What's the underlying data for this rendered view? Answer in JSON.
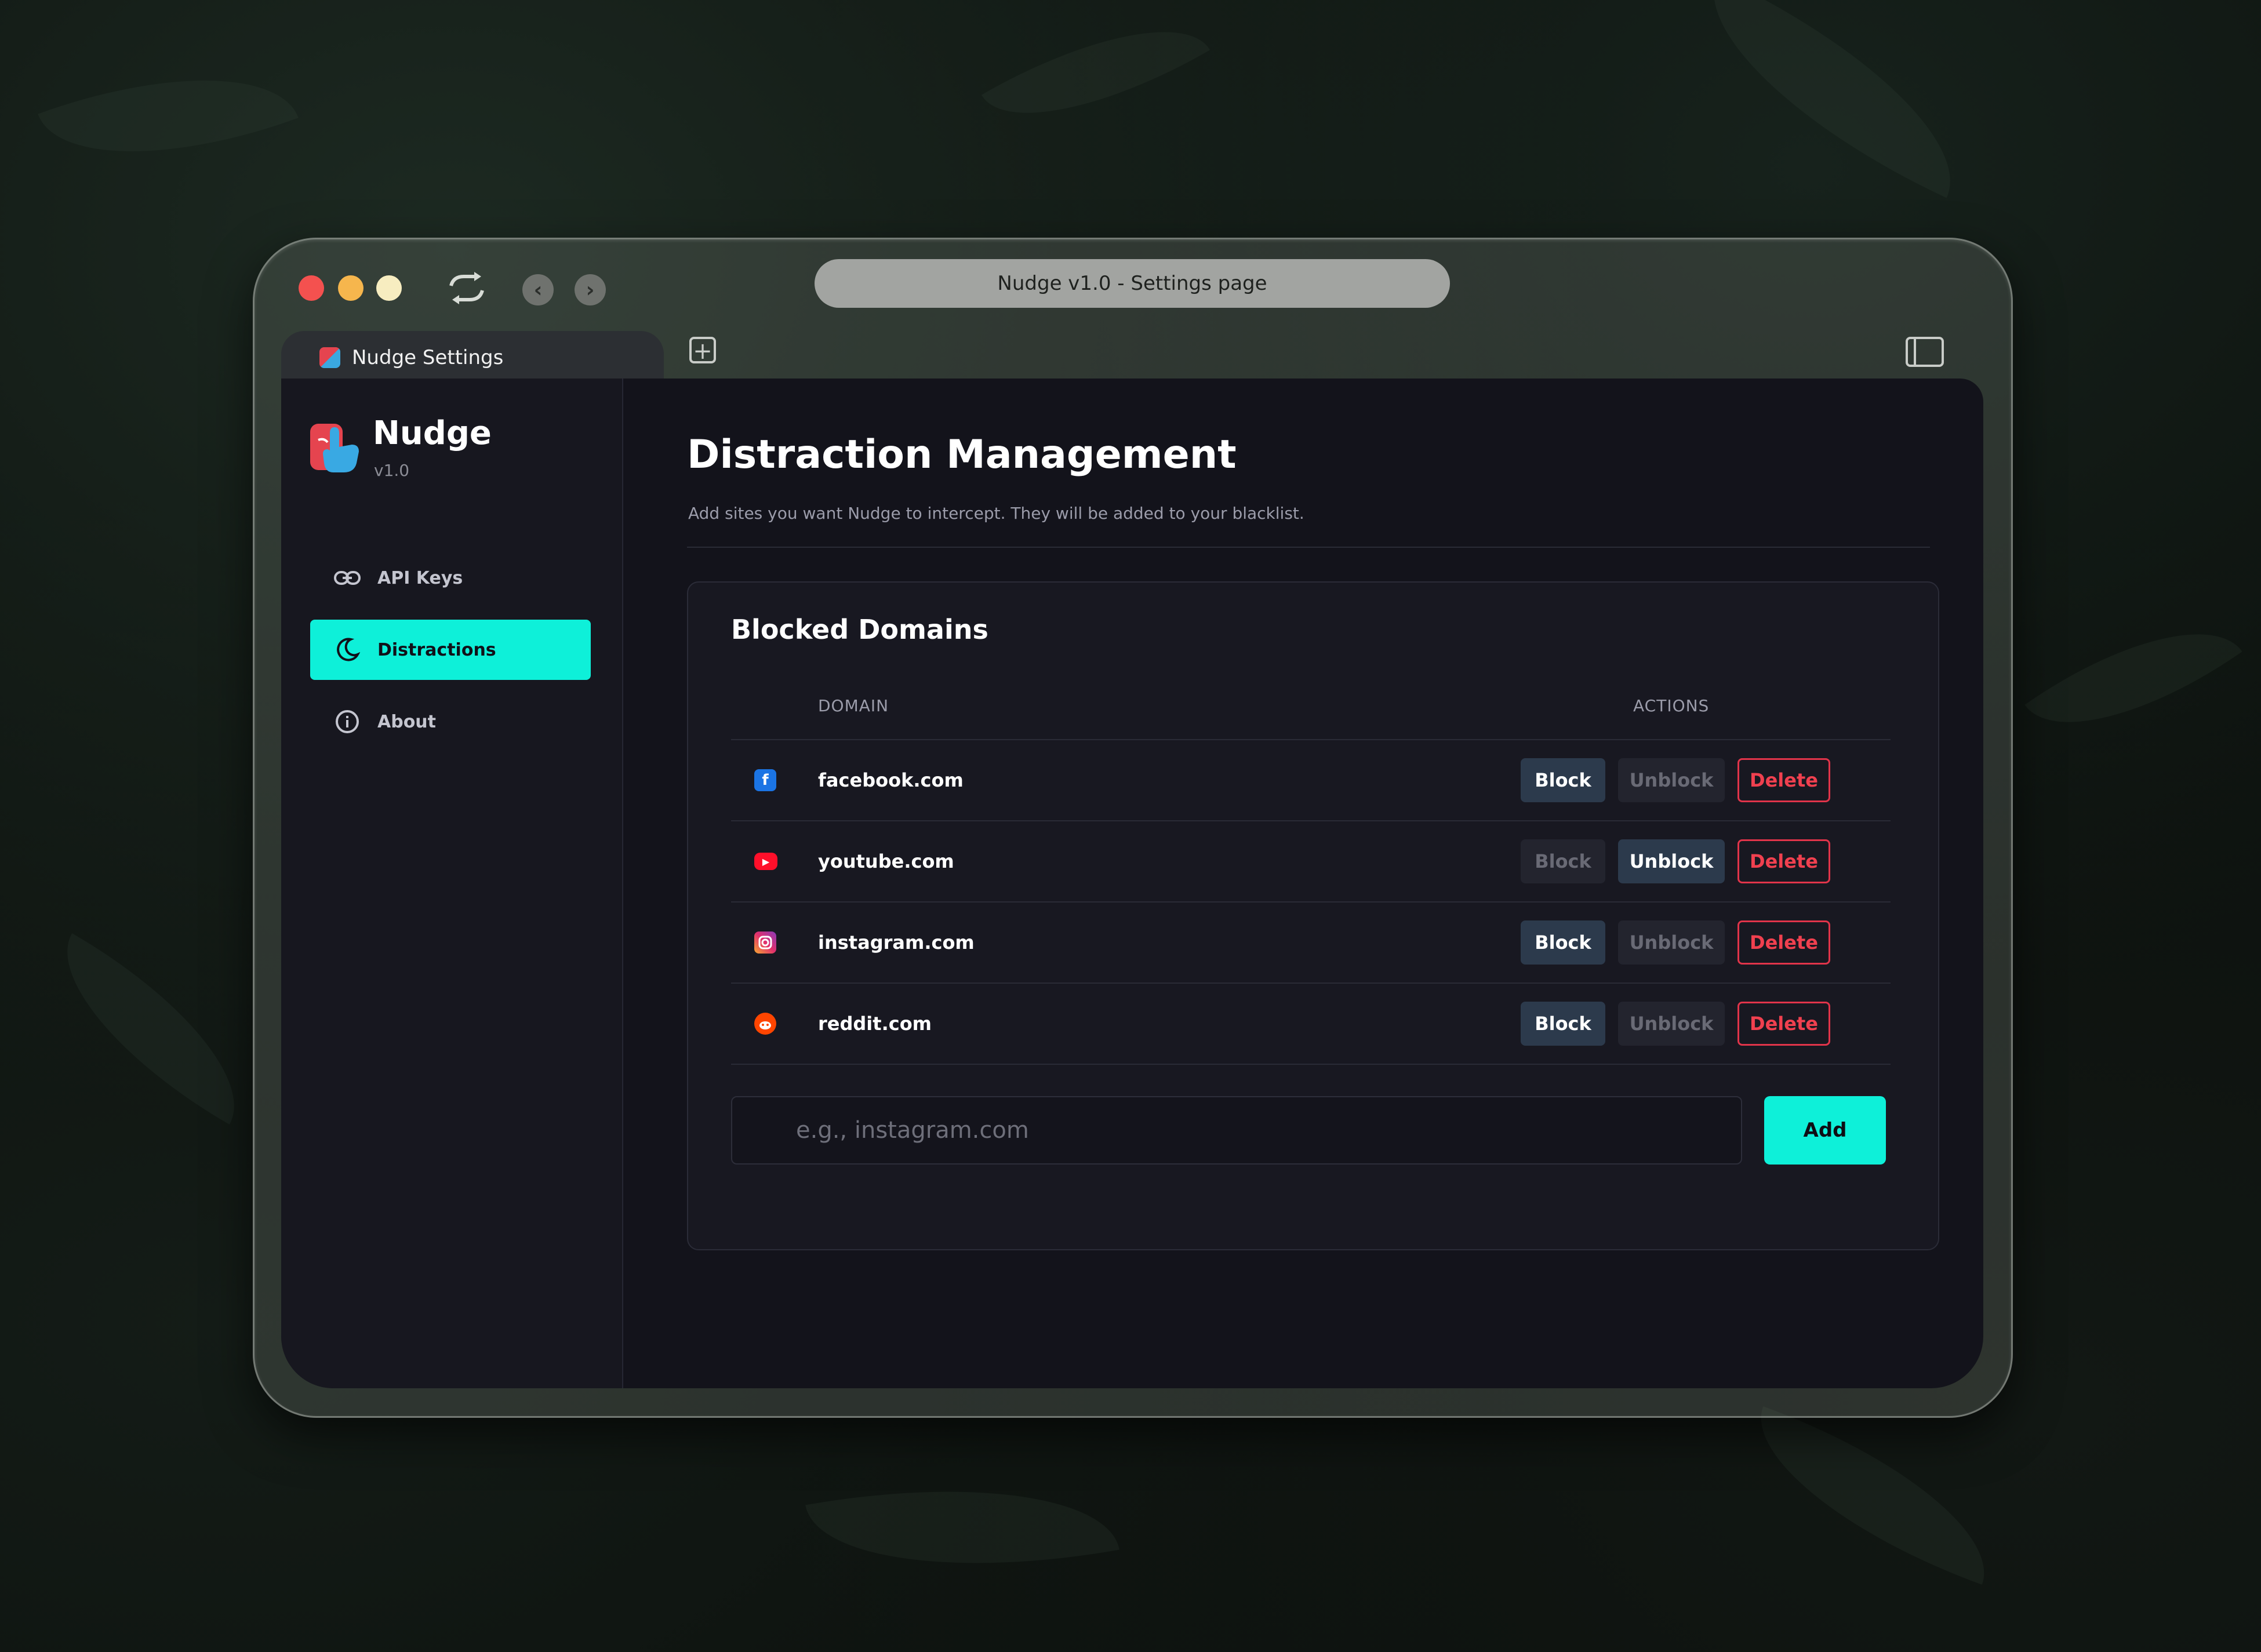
{
  "browser": {
    "address_text": "Nudge v1.0 - Settings page",
    "tab_title": "Nudge Settings"
  },
  "sidebar": {
    "brand_name": "Nudge",
    "brand_version": "v1.0",
    "items": [
      {
        "label": "API Keys",
        "icon": "link-icon",
        "active": false
      },
      {
        "label": "Distractions",
        "icon": "moon-icon",
        "active": true
      },
      {
        "label": "About",
        "icon": "info-icon",
        "active": false
      }
    ]
  },
  "main": {
    "title": "Distraction Management",
    "subtitle": "Add sites you want Nudge to intercept. They will be added to your blacklist.",
    "card": {
      "title": "Blocked Domains",
      "columns": {
        "domain": "DOMAIN",
        "actions": "ACTIONS"
      },
      "rows": [
        {
          "domain": "facebook.com",
          "icon": "facebook-icon",
          "state": "unblocked"
        },
        {
          "domain": "youtube.com",
          "icon": "youtube-icon",
          "state": "blocked"
        },
        {
          "domain": "instagram.com",
          "icon": "instagram-icon",
          "state": "unblocked"
        },
        {
          "domain": "reddit.com",
          "icon": "reddit-icon",
          "state": "unblocked"
        }
      ],
      "actions": {
        "block": "Block",
        "unblock": "Unblock",
        "delete": "Delete"
      },
      "add_input": {
        "value": "",
        "placeholder": "e.g., instagram.com"
      },
      "add_button": "Add"
    }
  },
  "colors": {
    "accent": "#0ef0d9",
    "danger": "#f0404f",
    "panel": "#13131b"
  }
}
